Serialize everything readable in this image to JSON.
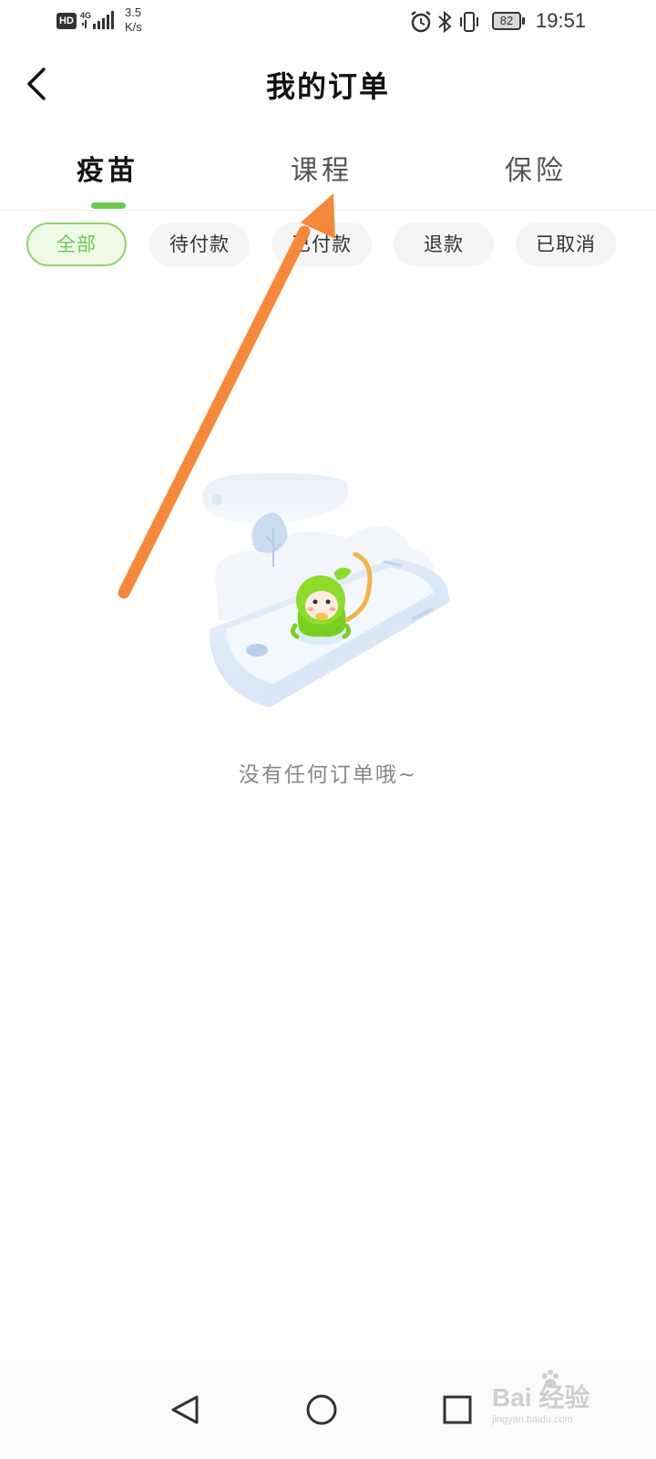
{
  "status_bar": {
    "hd": "HD",
    "network": "4G",
    "speed_value": "3.5",
    "speed_unit": "K/s",
    "battery": "82",
    "time": "19:51"
  },
  "header": {
    "title": "我的订单",
    "back_icon": "chevron-left-icon"
  },
  "tabs": [
    {
      "label": "疫苗",
      "active": true
    },
    {
      "label": "课程",
      "active": false
    },
    {
      "label": "保险",
      "active": false
    }
  ],
  "filters": [
    {
      "label": "全部",
      "active": true
    },
    {
      "label": "待付款",
      "active": false
    },
    {
      "label": "已付款",
      "active": false
    },
    {
      "label": "退款",
      "active": false
    },
    {
      "label": "已取消",
      "active": false
    }
  ],
  "empty_state": {
    "message": "没有任何订单哦~",
    "illustration": "phone-with-mascot-illustration"
  },
  "nav": {
    "back_icon": "triangle-back-icon",
    "home_icon": "circle-home-icon",
    "recents_icon": "square-recents-icon"
  },
  "watermark": {
    "brand": "Bai  经验",
    "url": "jingyan.baidu.com"
  },
  "colors": {
    "accent_green": "#6ccb4f",
    "annotation_orange": "#f5883a",
    "text_gray": "#888888"
  }
}
